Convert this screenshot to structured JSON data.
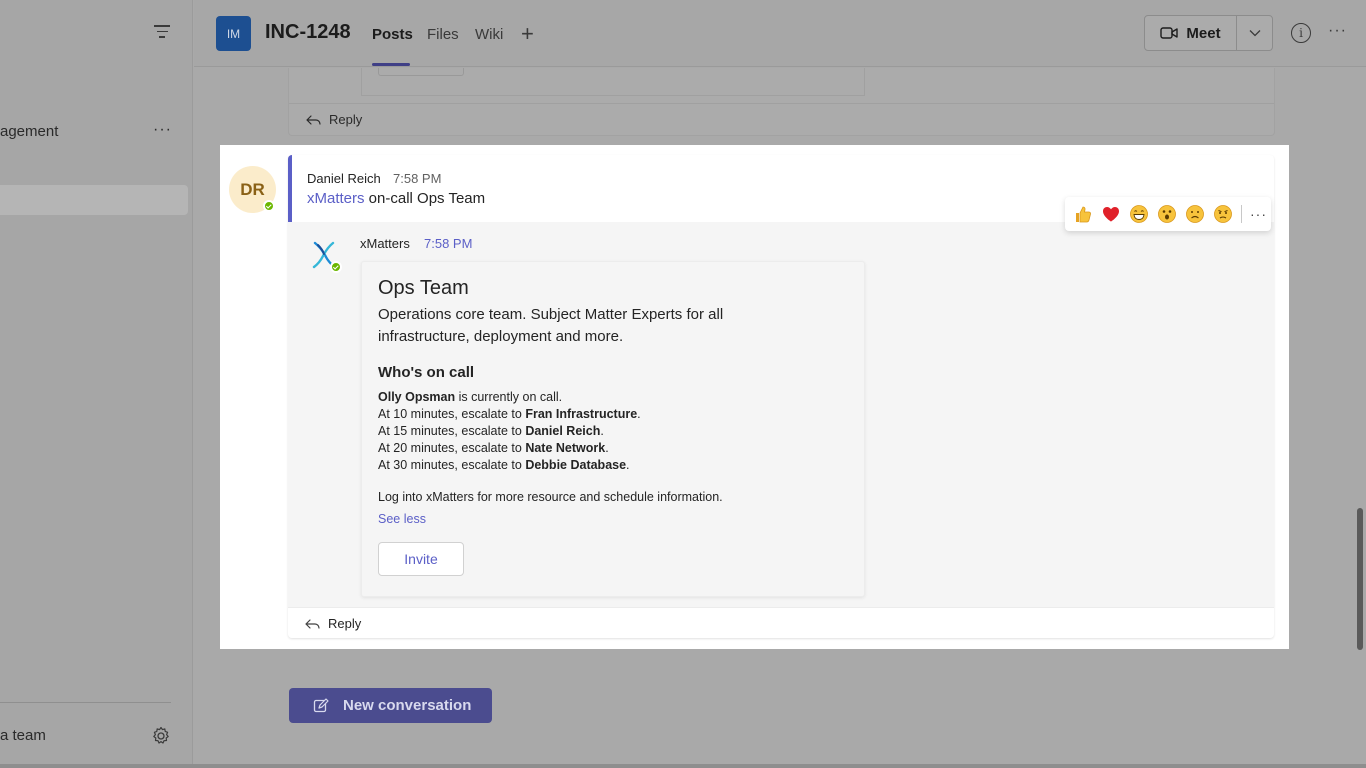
{
  "sidebar": {
    "channel_label": "agement",
    "join_team_label": "a team",
    "more_label": "···"
  },
  "header": {
    "team_avatar": "IM",
    "title": "INC-1248",
    "tabs": [
      {
        "label": "Posts",
        "active": true
      },
      {
        "label": "Files",
        "active": false
      },
      {
        "label": "Wiki",
        "active": false
      }
    ],
    "add_tab": "+",
    "meet_label": "Meet",
    "more_label": "···"
  },
  "previous_post": {
    "reply_label": "Reply"
  },
  "post": {
    "avatar_initials": "DR",
    "author": "Daniel Reich",
    "time": "7:58 PM",
    "subject_link": "xMatters",
    "subject_rest": " on-call Ops Team",
    "reply": {
      "bot_name": "xMatters",
      "time": "7:58 PM",
      "card": {
        "title": "Ops Team",
        "description": "Operations core team. Subject Matter Experts for all infrastructure, deployment and more.",
        "section_title": "Who's on call",
        "oncall_name": "Olly Opsman",
        "oncall_suffix": " is currently on call.",
        "escalations": [
          {
            "prefix": "At 10 minutes, escalate to ",
            "name": "Fran Infrastructure",
            "suffix": "."
          },
          {
            "prefix": "At 15 minutes, escalate to ",
            "name": "Daniel Reich",
            "suffix": "."
          },
          {
            "prefix": "At 20 minutes, escalate to ",
            "name": "Nate Network",
            "suffix": "."
          },
          {
            "prefix": "At 30 minutes, escalate to ",
            "name": "Debbie Database",
            "suffix": "."
          }
        ],
        "note": "Log into xMatters for more resource and schedule information.",
        "see_less": "See less",
        "invite_label": "Invite"
      }
    },
    "reply_label": "Reply",
    "reactions": [
      "thumbs-up",
      "heart",
      "laugh",
      "surprised",
      "sad",
      "angry"
    ],
    "more_label": "···"
  },
  "new_conversation_label": "New conversation",
  "colors": {
    "accent": "#5b5fc7",
    "presence": "#6bb700",
    "team_avatar": "#1d4f91",
    "author_avatar_bg": "#fbeccb"
  }
}
